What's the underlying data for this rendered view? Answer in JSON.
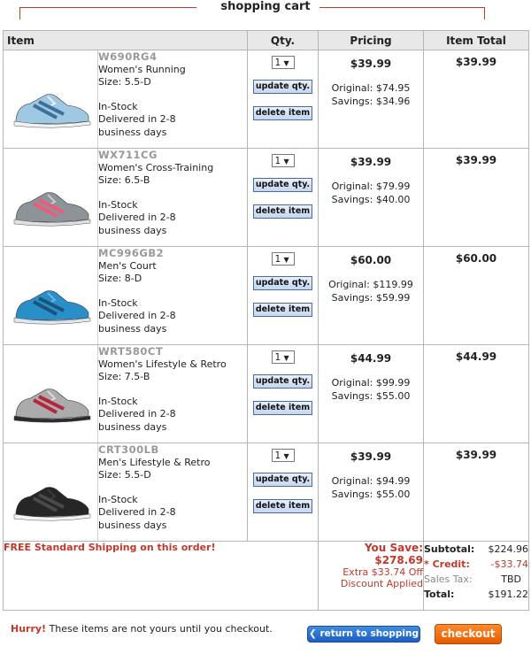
{
  "page": {
    "title": "shopping cart"
  },
  "columns": {
    "item": "Item",
    "qty": "Qty.",
    "pricing": "Pricing",
    "item_total": "Item Total"
  },
  "buttons": {
    "update": "update qty.",
    "delete": "delete item"
  },
  "items": [
    {
      "sku": "W690RG4",
      "name": "Women's Running",
      "size": "Size: 5.5-D",
      "stock": "In-Stock",
      "delivery1": "Delivered in 2-8",
      "delivery2": "business days",
      "qty": "1",
      "price": "$39.99",
      "original": "Original: $74.95",
      "savings": "Savings: $34.96",
      "total": "$39.99",
      "colors": {
        "body": "#9fc8e3",
        "accent": "#3c6f9a",
        "sole": "#f2f2f2",
        "stripe": "#e6f1f8"
      }
    },
    {
      "sku": "WX711CG",
      "name": "Women's Cross-Training",
      "size": "Size: 6.5-B",
      "stock": "In-Stock",
      "delivery1": "Delivered in 2-8",
      "delivery2": "business days",
      "qty": "1",
      "price": "$39.99",
      "original": "Original: $79.99",
      "savings": "Savings: $40.00",
      "total": "$39.99",
      "colors": {
        "body": "#8d9398",
        "accent": "#ee5a7a",
        "sole": "#e0e0e0",
        "stripe": "#c7cbcf"
      }
    },
    {
      "sku": "MC996GB2",
      "name": "Men's Court",
      "size": "Size: 8-D",
      "stock": "In-Stock",
      "delivery1": "Delivered in 2-8",
      "delivery2": "business days",
      "qty": "1",
      "price": "$60.00",
      "original": "Original: $119.99",
      "savings": "Savings: $59.99",
      "total": "$60.00",
      "colors": {
        "body": "#2a8fc9",
        "accent": "#1a5478",
        "sole": "#dfe6ea",
        "stripe": "#6cb6e0"
      }
    },
    {
      "sku": "WRT580CT",
      "name": "Women's Lifestyle & Retro",
      "size": "Size: 7.5-B",
      "stock": "In-Stock",
      "delivery1": "Delivered in 2-8",
      "delivery2": "business days",
      "qty": "1",
      "price": "$44.99",
      "original": "Original: $99.99",
      "savings": "Savings: $55.00",
      "total": "$44.99",
      "colors": {
        "body": "#a9abad",
        "accent": "#b8243a",
        "sole": "#2a2a2a",
        "stripe": "#d8d9da"
      }
    },
    {
      "sku": "CRT300LB",
      "name": "Men's Lifestyle & Retro",
      "size": "Size: 5.5-D",
      "stock": "In-Stock",
      "delivery1": "Delivered in 2-8",
      "delivery2": "business days",
      "qty": "1",
      "price": "$39.99",
      "original": "Original: $94.99",
      "savings": "Savings: $55.00",
      "total": "$39.99",
      "colors": {
        "body": "#262626",
        "accent": "#4a4a4a",
        "sole": "#f4f4f4",
        "stripe": "#3a3a3a"
      }
    }
  ],
  "footer": {
    "shipping": "FREE Standard Shipping on this order!",
    "you_save": "You Save: $278.69",
    "extra": "Extra $33.74 Off Discount Applied",
    "subtotal_label": "Subtotal:",
    "subtotal_value": "$224.96",
    "credit_label": "* Credit:",
    "credit_value": "-$33.74",
    "tax_label": "Sales Tax:",
    "tax_value": "TBD",
    "total_label": "Total:",
    "total_value": "$191.22"
  },
  "bottom": {
    "hurry": "Hurry!",
    "hurry_text": " These items are not yours until you checkout.",
    "return": "return to shopping",
    "checkout": "checkout"
  },
  "icons": {
    "return_icon": "chevron-left-icon",
    "checkout_icon": "chevron-right-icon"
  }
}
